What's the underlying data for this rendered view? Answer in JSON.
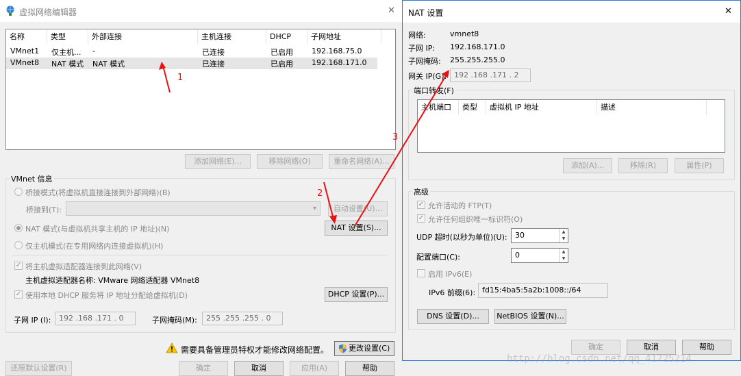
{
  "editor": {
    "title": "虚拟网络编辑器",
    "close_glyph": "✕",
    "table": {
      "headers": [
        "名称",
        "类型",
        "外部连接",
        "主机连接",
        "DHCP",
        "子网地址"
      ],
      "rows": [
        [
          "VMnet1",
          "仅主机...",
          "-",
          "已连接",
          "已启用",
          "192.168.75.0"
        ],
        [
          "VMnet8",
          "NAT 模式",
          "NAT 模式",
          "已连接",
          "已启用",
          "192.168.171.0"
        ]
      ]
    },
    "add_network": "添加网络(E)...",
    "remove_network": "移除网络(O)",
    "rename_network": "重命名网络(A)...",
    "vmnet_info": "VMnet 信息",
    "bridge_mode": "桥接模式(将虚拟机直接连接到外部网络)(B)",
    "bridge_to": "桥接到(T):",
    "auto_settings": "自动设置(U)...",
    "nat_mode": "NAT 模式(与虚拟机共享主机的 IP 地址)(N)",
    "nat_settings": "NAT 设置(S)...",
    "host_only": "仅主机模式(在专用网络内连接虚拟机)(H)",
    "connect_adapter": "将主机虚拟适配器连接到此网络(V)",
    "adapter_name": "主机虚拟适配器名称: VMware 网络适配器 VMnet8",
    "use_dhcp": "使用本地 DHCP 服务将 IP 地址分配给虚拟机(D)",
    "dhcp_settings": "DHCP 设置(P)...",
    "subnet_ip_label": "子网 IP (I):",
    "subnet_ip": "192 .168 .171 .  0",
    "subnet_mask_label": "子网掩码(M):",
    "subnet_mask": "255 .255 .255 .  0",
    "admin_warning": "需要具备管理员特权才能修改网络配置。",
    "change_settings": "更改设置(C)",
    "restore_defaults": "还原默认设置(R)",
    "ok": "确定",
    "cancel": "取消",
    "apply": "应用(A)",
    "help": "帮助"
  },
  "nat": {
    "title": "NAT 设置",
    "close_glyph": "✕",
    "network_label": "网络:",
    "network_value": "vmnet8",
    "subnet_ip_label": "子网 IP:",
    "subnet_ip_value": "192.168.171.0",
    "subnet_mask_label": "子网掩码:",
    "subnet_mask_value": "255.255.255.0",
    "gateway_label": "网关 IP(G):",
    "gateway_value": "192 .168 .171 .  2",
    "port_forward": "端口转发(F)",
    "pf_headers": [
      "主机端口",
      "类型",
      "虚拟机 IP 地址",
      "描述"
    ],
    "add": "添加(A)...",
    "remove": "移除(R)",
    "properties": "属性(P)",
    "advanced": "高级",
    "allow_ftp": "允许活动的 FTP(T)",
    "allow_uid": "允许任何组织唯一标识符(O)",
    "udp_timeout_label": "UDP 超时(以秒为单位)(U):",
    "udp_timeout_value": "30",
    "config_port_label": "配置端口(C):",
    "config_port_value": "0",
    "enable_ipv6": "启用 IPv6(E)",
    "ipv6_prefix_label": "IPv6 前缀(6):",
    "ipv6_prefix_value": "fd15:4ba5:5a2b:1008::/64",
    "dns_settings": "DNS 设置(D)...",
    "netbios_settings": "NetBIOS 设置(N)...",
    "ok": "确定",
    "cancel": "取消",
    "help": "帮助"
  },
  "annotations": {
    "n1": "1",
    "n2": "2",
    "n3": "3",
    "watermark": "http://blog.csdn.net/qq_41725214"
  }
}
